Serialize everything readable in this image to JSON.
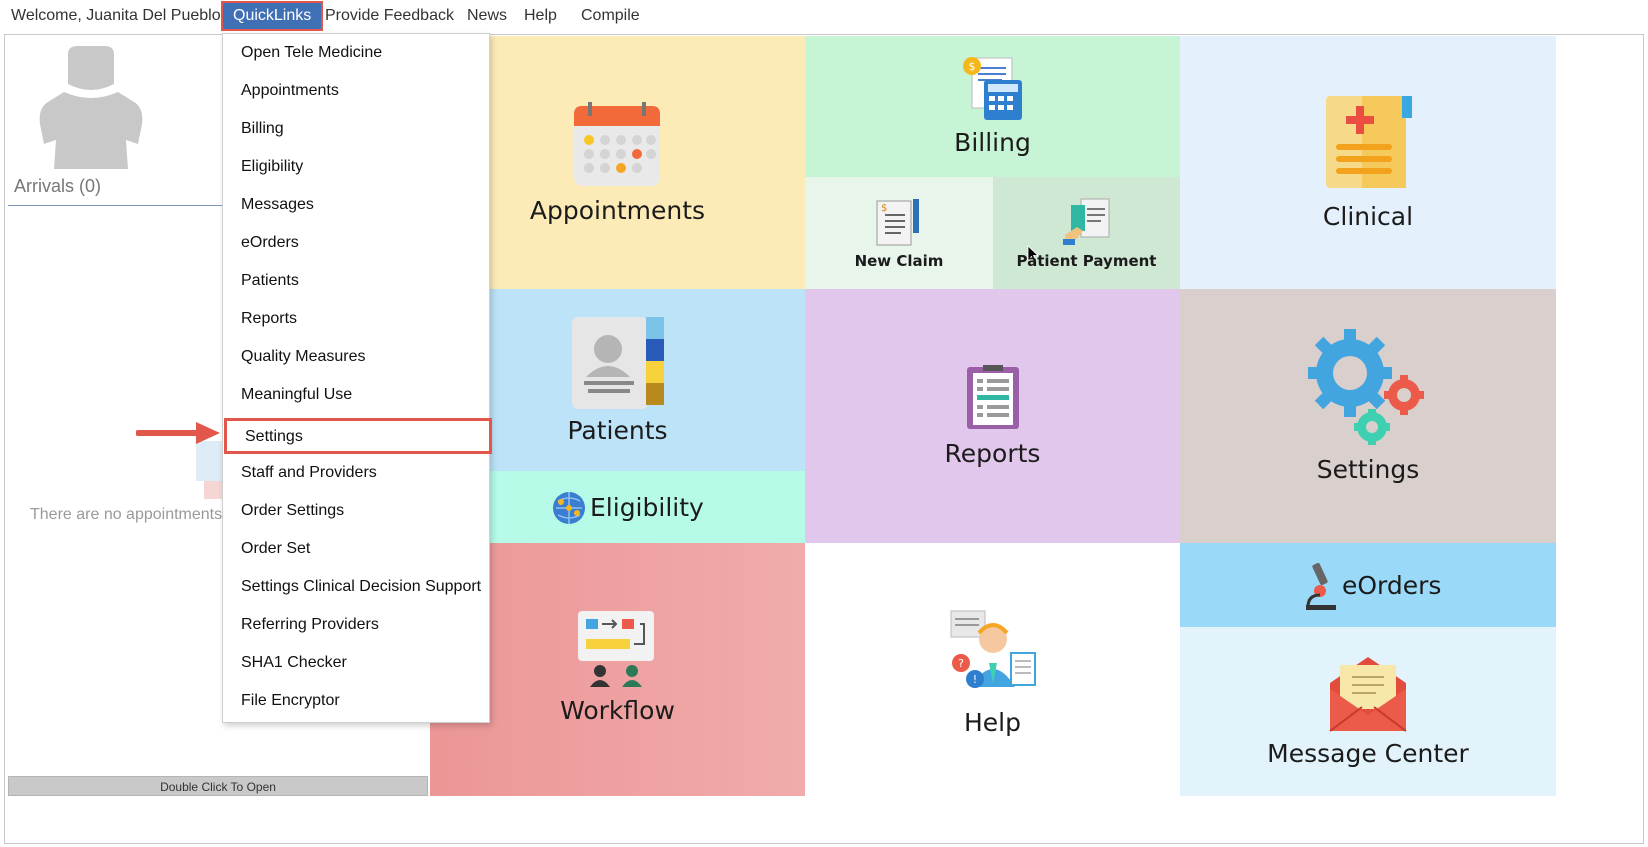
{
  "nav": {
    "welcome": "Welcome, Juanita Del Pueblo",
    "quicklinks": "QuickLinks",
    "feedback": "Provide Feedback",
    "news": "News",
    "help": "Help",
    "compile": "Compile"
  },
  "left_panel": {
    "arrivals": "Arrivals (0)",
    "no_appointments": "There are no appointments r",
    "double_click": "Double Click To Open"
  },
  "quicklinks_menu": {
    "items": [
      "Open Tele Medicine",
      "Appointments",
      "Billing",
      "Eligibility",
      "Messages",
      "eOrders",
      "Patients",
      "Reports",
      "Quality Measures",
      "Meaningful Use",
      "Settings",
      "Staff and Providers",
      "Order Settings",
      "Order Set",
      "Settings Clinical Decision Support",
      "Referring Providers",
      "SHA1 Checker",
      "File Encryptor"
    ],
    "highlighted": "Settings"
  },
  "tiles": {
    "appointments": "Appointments",
    "billing": "Billing",
    "new_claim": "New Claim",
    "patient_payment": "Patient Payment",
    "clinical": "Clinical",
    "patients": "Patients",
    "eligibility": "Eligibility",
    "reports": "Reports",
    "settings": "Settings",
    "workflow": "Workflow",
    "help": "Help",
    "eorders": "eOrders",
    "message_center": "Message Center"
  },
  "colors": {
    "quicklinks_bg": "#3f6fb5",
    "highlight_border": "#e2574c",
    "appointments_bg": "#fdebb7",
    "billing_bg": "#c6f4d4",
    "new_claim_bg": "#e8f5ea",
    "patient_payment_bg": "#cfe8d3",
    "clinical_bg": "#e4f0fb",
    "patients_bg": "#bce3f8",
    "eligibility_bg": "#b5fbe8",
    "reports_bg": "#e2c7ec",
    "settings_bg": "#d9cfcc",
    "workflow_bg": "#ee9d9d",
    "help_bg": "#ffffff",
    "eorders_bg": "#9ad9f8",
    "message_center_bg": "#e3f3fc"
  }
}
